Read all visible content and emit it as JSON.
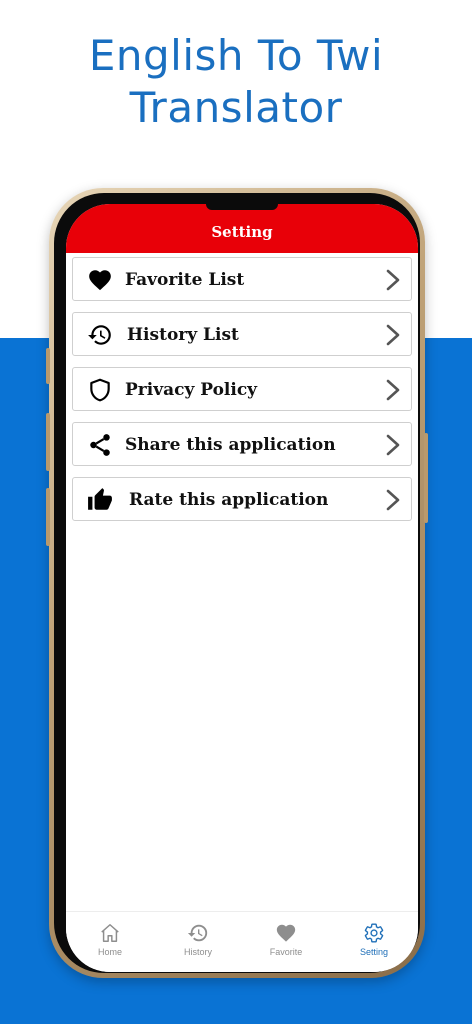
{
  "promo": {
    "title_line1": "English To Twi",
    "title_line2": "Translator"
  },
  "header": {
    "title": "Setting"
  },
  "menu": [
    {
      "label": "Favorite List",
      "icon": "heart-icon"
    },
    {
      "label": "History List",
      "icon": "history-icon"
    },
    {
      "label": "Privacy Policy",
      "icon": "shield-icon"
    },
    {
      "label": "Share this application",
      "icon": "share-icon"
    },
    {
      "label": "Rate this application",
      "icon": "thumb-up-icon"
    }
  ],
  "tabs": [
    {
      "label": "Home",
      "icon": "home-icon"
    },
    {
      "label": "History",
      "icon": "history-icon"
    },
    {
      "label": "Favorite",
      "icon": "heart-icon"
    },
    {
      "label": "Setting",
      "icon": "gear-icon",
      "active": true
    }
  ],
  "colors": {
    "header": "#e80008",
    "background_blue": "#0a73d4",
    "title_blue": "#1a6fc0",
    "active_tab": "#1f6fb8",
    "inactive_tab": "#8e8e8e"
  }
}
